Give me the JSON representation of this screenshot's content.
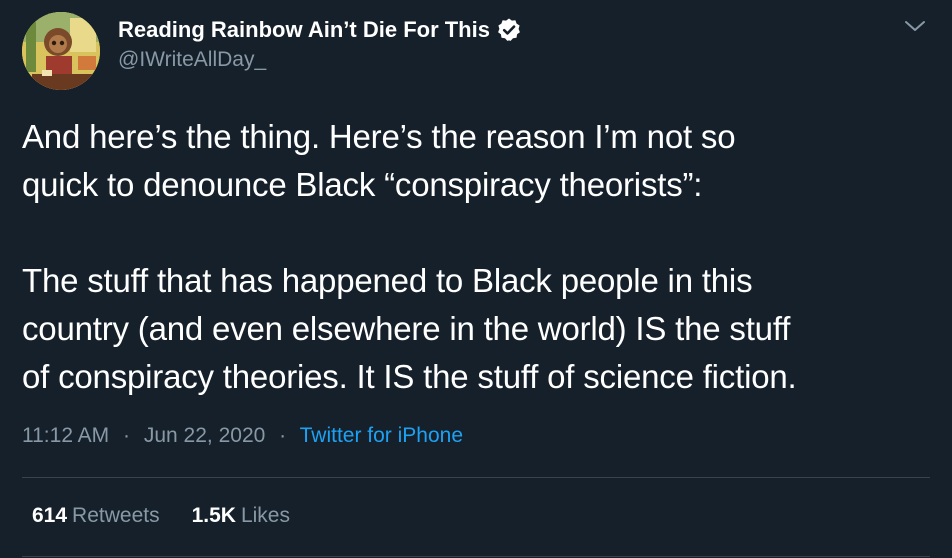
{
  "author": {
    "display_name": "Reading Rainbow Ain’t Die For This",
    "handle": "@IWriteAllDay_",
    "verified": true
  },
  "tweet": {
    "lines_para1": [
      "And here’s the thing. Here’s the reason I’m not so",
      "quick to denounce Black “conspiracy theorists”:"
    ],
    "lines_para2": [
      "The stuff that has happened to Black people in this",
      "country (and even elsewhere in the world) IS the stuff",
      "of conspiracy theories. It IS the stuff of science fiction."
    ]
  },
  "meta": {
    "time": "11:12 AM",
    "separator": "·",
    "date": "Jun 22, 2020",
    "source": "Twitter for iPhone"
  },
  "stats": {
    "retweets_count": "614",
    "retweets_label": "Retweets",
    "likes_count": "1.5K",
    "likes_label": "Likes"
  },
  "icons": {
    "verified": "verified-badge-icon",
    "more": "chevron-down-icon"
  },
  "colors": {
    "background": "#15202b",
    "text_primary": "#ffffff",
    "text_secondary": "#8899a6",
    "link": "#1da1f2",
    "divider": "#38444d"
  }
}
